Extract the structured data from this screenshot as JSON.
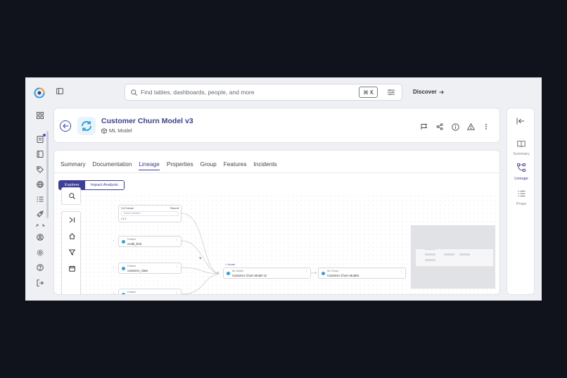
{
  "app": {
    "search_placeholder": "Find tables, dashboards, people, and more",
    "shortcut": "⌘ K",
    "discover_label": "Discover"
  },
  "entity": {
    "title": "Customer Churn Model v3",
    "type": "ML Model"
  },
  "tabs": [
    "Summary",
    "Documentation",
    "Lineage",
    "Properties",
    "Group",
    "Features",
    "Incidents"
  ],
  "active_tab": "Lineage",
  "lineage_modes": [
    "Explorer",
    "Impact Analysis"
  ],
  "lineage": {
    "search_node": {
      "count": "3 of 3 shown",
      "more": "Show all",
      "placeholder": "Search children",
      "filter": "4 ▾ 2"
    },
    "features": [
      {
        "type": "Feature",
        "name": "credit_limit"
      },
      {
        "type": "Feature",
        "name": "customer_class"
      },
      {
        "type": "Feature",
        "name": "customer_since"
      }
    ],
    "model": {
      "badge": "Home",
      "type": "ML Model",
      "name": "Customer Churn Model v3"
    },
    "group": {
      "type": "ML Group",
      "name": "Customer Churn Models"
    },
    "edge_count": "3"
  },
  "right_panel": {
    "items": [
      {
        "label": "Summary",
        "icon": "book-icon"
      },
      {
        "label": "Lineage",
        "icon": "lineage-icon"
      },
      {
        "label": "Props",
        "icon": "list-icon"
      }
    ]
  },
  "colors": {
    "accent": "#3d3d9a",
    "node_dot": "#2aa3e0",
    "page_bg": "#eef0f4",
    "outer_bg": "#11131c"
  }
}
